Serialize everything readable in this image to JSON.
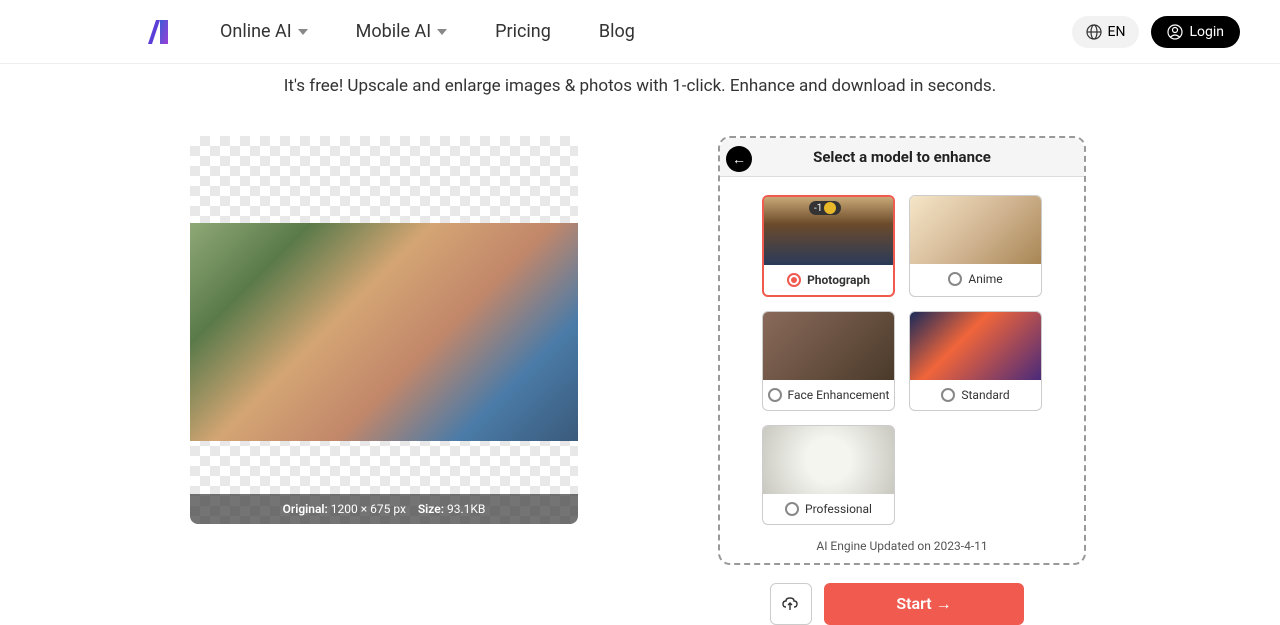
{
  "nav": {
    "items": [
      "Online AI",
      "Mobile AI",
      "Pricing",
      "Blog"
    ],
    "lang": "EN",
    "login": "Login"
  },
  "tagline": "It's free! Upscale and enlarge images & photos with 1-click. Enhance and download in seconds.",
  "preview": {
    "original_label": "Original:",
    "dimensions": "1200 × 675 px",
    "size_label": "Size:",
    "size": "93.1KB"
  },
  "panel": {
    "title": "Select a model to enhance",
    "models": [
      {
        "label": "Photograph",
        "selected": true,
        "badge": "-1"
      },
      {
        "label": "Anime",
        "selected": false
      },
      {
        "label": "Face Enhancement",
        "selected": false
      },
      {
        "label": "Standard",
        "selected": false
      },
      {
        "label": "Professional",
        "selected": false
      }
    ],
    "engine_note": "AI Engine Updated on 2023-4-11"
  },
  "actions": {
    "start": "Start →"
  }
}
